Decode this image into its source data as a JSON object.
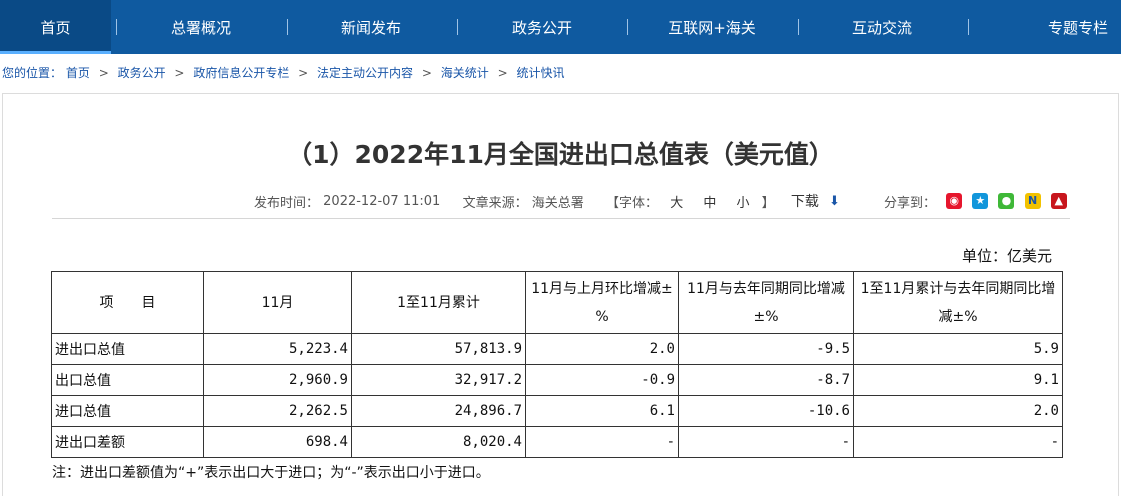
{
  "nav": {
    "items": [
      {
        "label": "首页"
      },
      {
        "label": "总署概况"
      },
      {
        "label": "新闻发布"
      },
      {
        "label": "政务公开"
      },
      {
        "label": "互联网+海关"
      },
      {
        "label": "互动交流"
      },
      {
        "label": "专题专栏"
      }
    ],
    "separator": "|"
  },
  "breadcrumb": {
    "prefix": "您的位置：",
    "items": [
      "首页",
      "政务公开",
      "政府信息公开专栏",
      "法定主动公开内容",
      "海关统计",
      "统计快讯"
    ],
    "separator": ">"
  },
  "article": {
    "title": "（1）2022年11月全国进出口总值表（美元值）",
    "publish_label": "发布时间：",
    "publish_time": "2022-12-07 11:01",
    "source_label": "文章来源：",
    "source": "海关总署",
    "font_label": "【字体：",
    "font_sizes": [
      "大",
      "中",
      "小"
    ],
    "font_close": "】",
    "download_label": "下载",
    "share_label": "分享到：",
    "share_icons": [
      "weibo-icon",
      "qzone-icon",
      "wechat-icon",
      "n-icon",
      "renren-icon"
    ]
  },
  "table": {
    "unit": "单位：亿美元",
    "headers": [
      "项　　目",
      "11月",
      "1至11月累计",
      "11月与上月环比增减±%",
      "11月与去年同期同比增减±%",
      "1至11月累计与去年同期同比增减±%"
    ],
    "rows": [
      [
        "进出口总值",
        "5,223.4",
        "57,813.9",
        "2.0",
        "-9.5",
        "5.9"
      ],
      [
        "出口总值",
        "2,960.9",
        "32,917.2",
        "-0.9",
        "-8.7",
        "9.1"
      ],
      [
        "进口总值",
        "2,262.5",
        "24,896.7",
        "6.1",
        "-10.6",
        "2.0"
      ],
      [
        "进出口差额",
        "698.4",
        "8,020.4",
        "-",
        "-",
        "-"
      ]
    ],
    "note": "注：进出口差额值为“+”表示出口大于进口；为“-”表示出口小于进口。"
  }
}
